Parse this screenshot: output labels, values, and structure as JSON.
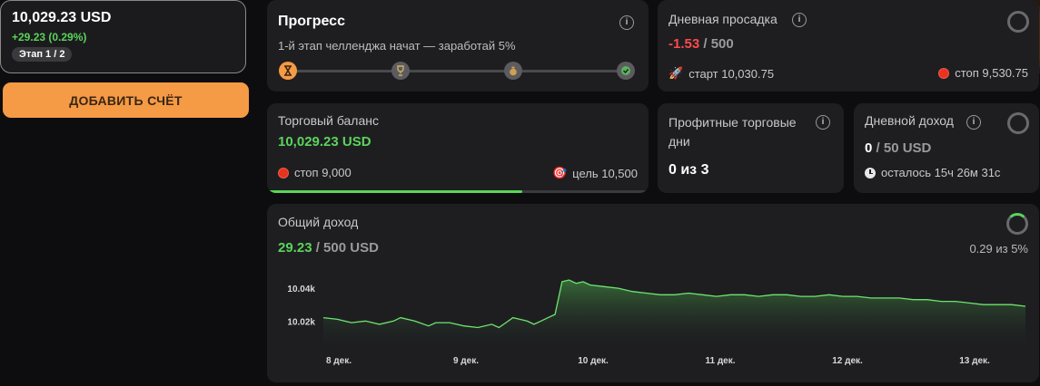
{
  "account": {
    "balance": "10,029.23 USD",
    "change": "+29.23 (0.29%)",
    "stage": "Этап 1 / 2",
    "icon": "cube-icon",
    "accent_color": "#f59a45"
  },
  "add_account_label": "ДОБАВИТЬ СЧЁТ",
  "progress": {
    "title": "Прогресс",
    "subtitle": "1-й этап челленджа начат — заработай 5%",
    "steps": [
      "hourglass-icon",
      "trophy-icon",
      "money-bag-icon",
      "check-icon"
    ]
  },
  "drawdown": {
    "title": "Дневная просадка",
    "value": "-1.53",
    "limit": "/ 500",
    "start": "старт 10,030.75",
    "stop": "стоп 9,530.75"
  },
  "balance": {
    "title": "Торговый баланс",
    "value": "10,029.23 USD",
    "stop": "стоп 9,000",
    "target": "цель 10,500",
    "progress_fraction": 0.67
  },
  "profit_days": {
    "title_line1": "Профитные торговые",
    "title_line2": "дни",
    "value": "0 из 3"
  },
  "daily_income": {
    "title": "Дневной доход",
    "value": "0",
    "limit": "/ 50 USD",
    "remaining": "осталось 15ч 26м 31с"
  },
  "total_income": {
    "title": "Общий доход",
    "value": "29.23",
    "limit": "/ 500 USD",
    "percent": "0.29 из 5%"
  },
  "colors": {
    "positive": "#5ad45a",
    "negative": "#ff4a4a",
    "background": "#0d0d0f",
    "card": "#1e1e21"
  },
  "chart_data": {
    "type": "area",
    "x_ticks": [
      "8 дек.",
      "9 дек.",
      "10 дек.",
      "11 дек.",
      "12 дек.",
      "13 дек."
    ],
    "y_ticks": [
      "10.04k",
      "10.02k"
    ],
    "y_tick_values": [
      10040,
      10020
    ],
    "ylim": [
      10003,
      10050
    ],
    "xlim": [
      0,
      100
    ],
    "values": [
      [
        0,
        10022
      ],
      [
        2,
        10021
      ],
      [
        4,
        10019
      ],
      [
        6,
        10020
      ],
      [
        8,
        10018
      ],
      [
        10,
        10020
      ],
      [
        11,
        10022
      ],
      [
        13,
        10020
      ],
      [
        15,
        10017
      ],
      [
        16,
        10019
      ],
      [
        18,
        10019
      ],
      [
        20,
        10017
      ],
      [
        22,
        10016
      ],
      [
        24,
        10018
      ],
      [
        25,
        10016
      ],
      [
        26,
        10019
      ],
      [
        27,
        10022
      ],
      [
        28,
        10021
      ],
      [
        29,
        10020
      ],
      [
        30,
        10018
      ],
      [
        31,
        10020
      ],
      [
        32,
        10022
      ],
      [
        33,
        10024
      ],
      [
        34,
        10044
      ],
      [
        35,
        10045
      ],
      [
        36,
        10043
      ],
      [
        37,
        10044
      ],
      [
        38,
        10042
      ],
      [
        40,
        10041
      ],
      [
        42,
        10040
      ],
      [
        44,
        10038
      ],
      [
        46,
        10037
      ],
      [
        48,
        10036
      ],
      [
        50,
        10036
      ],
      [
        52,
        10037
      ],
      [
        54,
        10036
      ],
      [
        56,
        10035
      ],
      [
        58,
        10036
      ],
      [
        60,
        10036
      ],
      [
        62,
        10035
      ],
      [
        64,
        10036
      ],
      [
        66,
        10036
      ],
      [
        68,
        10035
      ],
      [
        70,
        10035
      ],
      [
        72,
        10036
      ],
      [
        74,
        10035
      ],
      [
        76,
        10035
      ],
      [
        78,
        10034
      ],
      [
        80,
        10034
      ],
      [
        82,
        10034
      ],
      [
        84,
        10033
      ],
      [
        86,
        10033
      ],
      [
        88,
        10032
      ],
      [
        90,
        10032
      ],
      [
        92,
        10031
      ],
      [
        94,
        10030
      ],
      [
        96,
        10030
      ],
      [
        98,
        10030
      ],
      [
        100,
        10029
      ]
    ]
  }
}
